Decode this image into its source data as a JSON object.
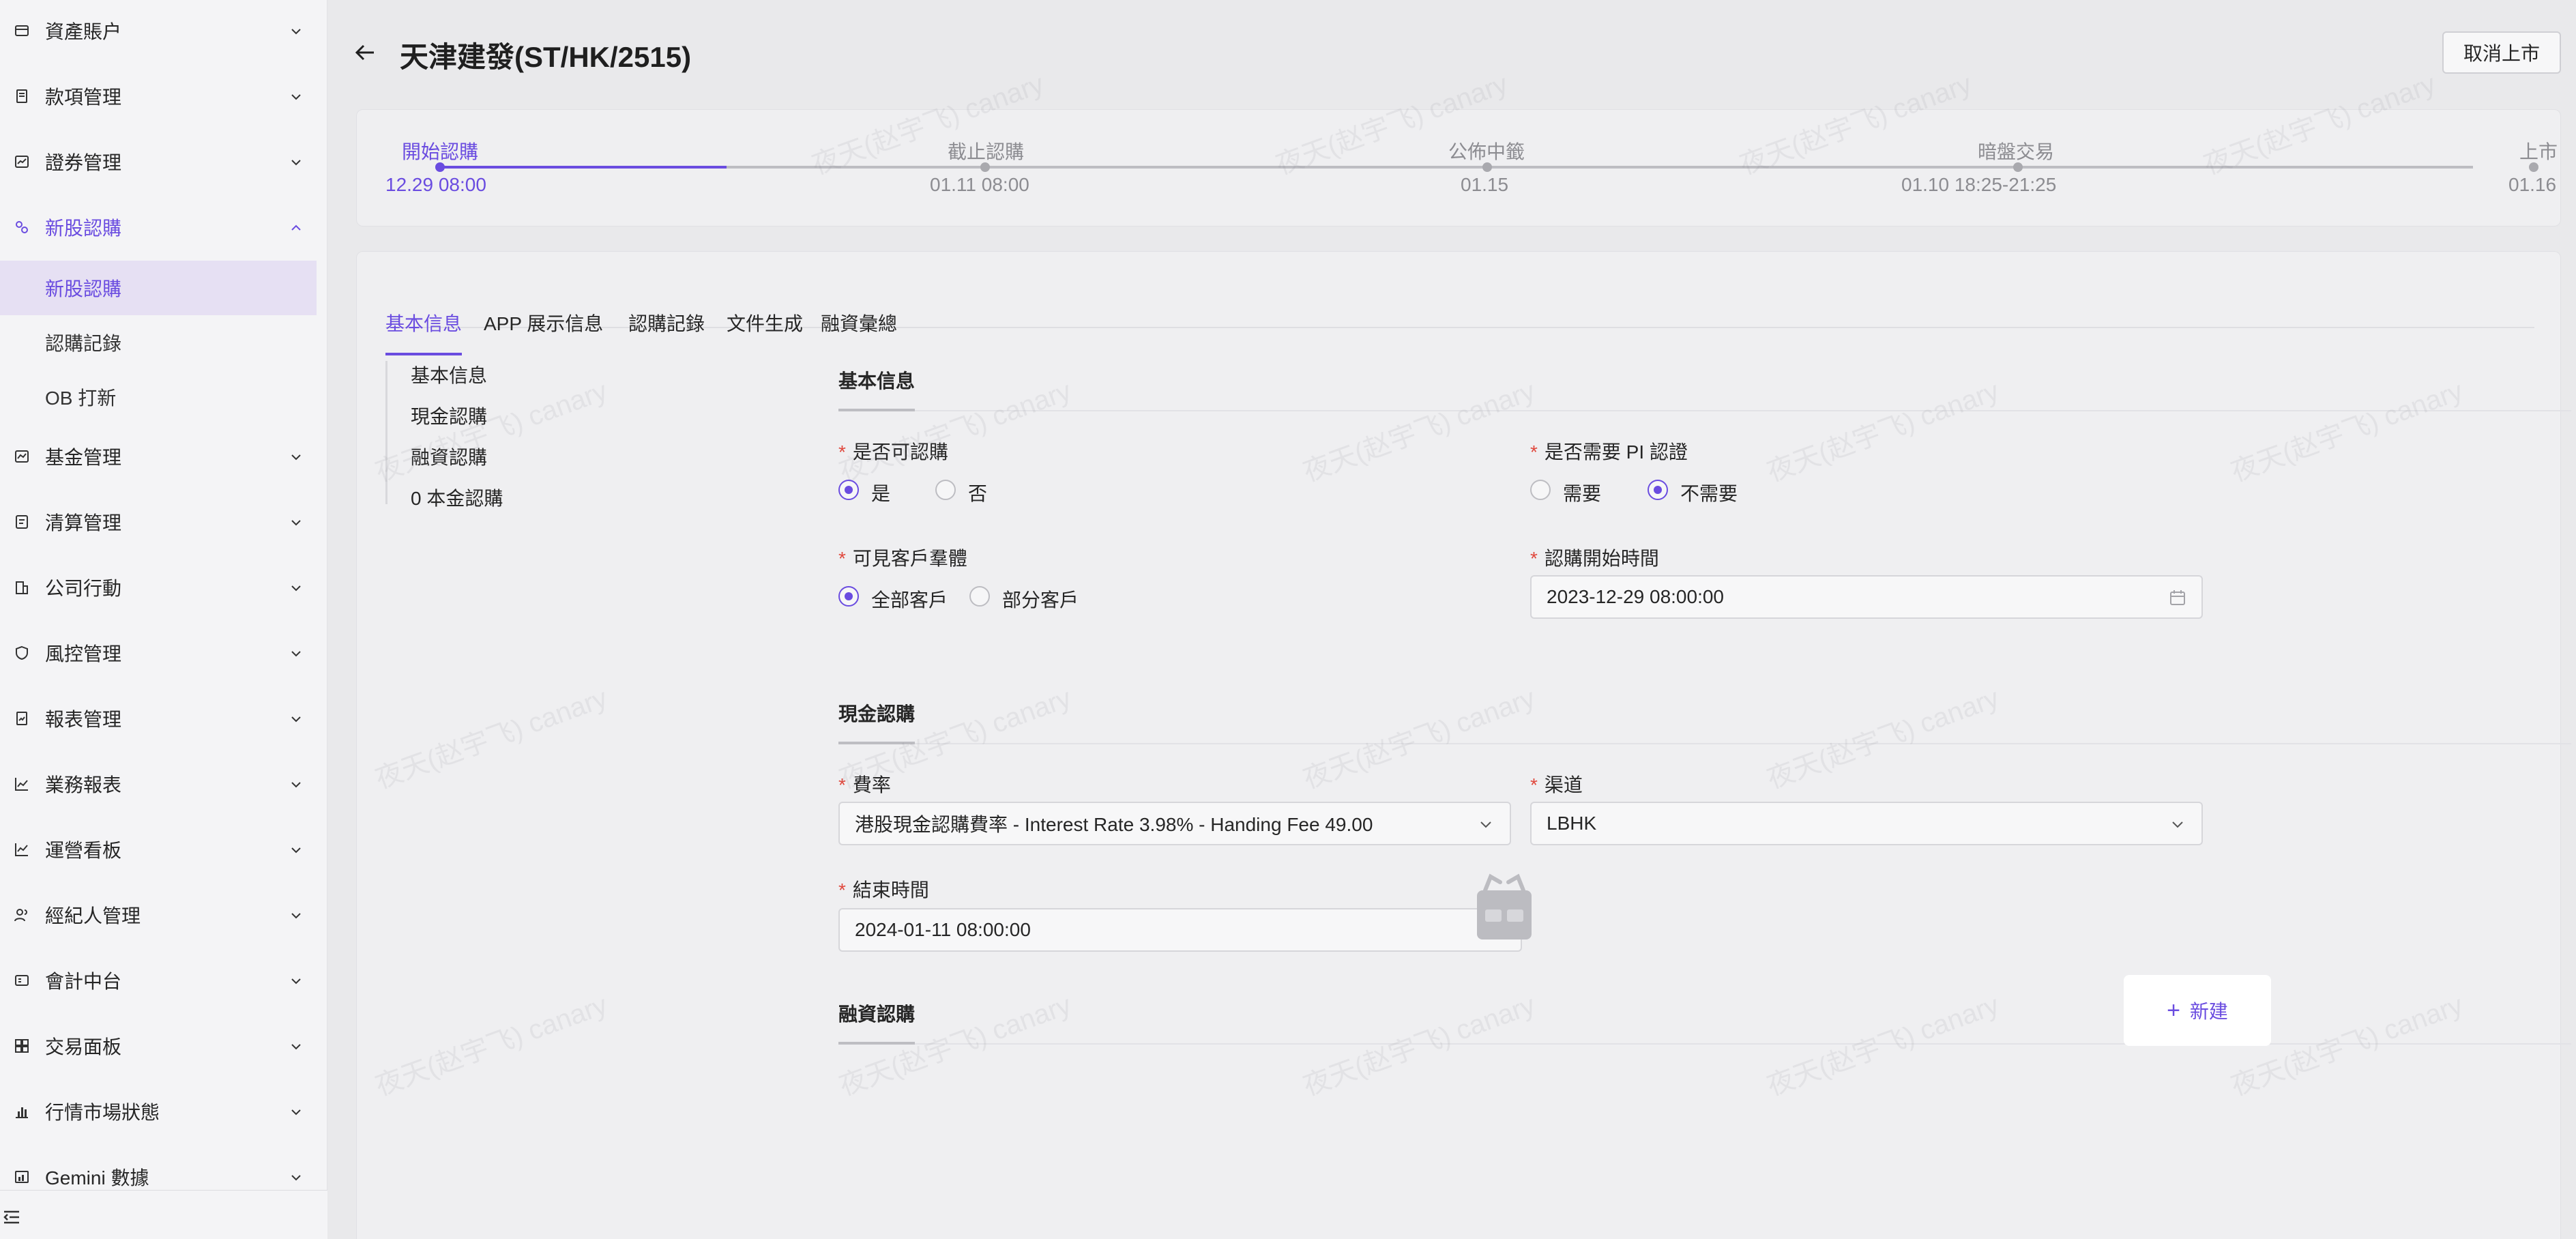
{
  "sidebar": {
    "items": [
      {
        "label": "資產賬户",
        "icon": "wallet-icon"
      },
      {
        "label": "款項管理",
        "icon": "receipt-icon"
      },
      {
        "label": "證券管理",
        "icon": "chart-box-icon"
      },
      {
        "label": "新股認購",
        "icon": "ipo-icon",
        "open": true,
        "children": [
          {
            "label": "新股認購",
            "active": true
          },
          {
            "label": "認購記錄"
          },
          {
            "label": "OB 打新"
          }
        ]
      },
      {
        "label": "基金管理",
        "icon": "fund-icon"
      },
      {
        "label": "清算管理",
        "icon": "clearing-icon"
      },
      {
        "label": "公司行動",
        "icon": "building-icon"
      },
      {
        "label": "風控管理",
        "icon": "shield-icon"
      },
      {
        "label": "報表管理",
        "icon": "report-icon"
      },
      {
        "label": "業務報表",
        "icon": "line-chart-icon"
      },
      {
        "label": "運營看板",
        "icon": "dashboard-icon"
      },
      {
        "label": "經紀人管理",
        "icon": "users-icon"
      },
      {
        "label": "會計中台",
        "icon": "accounting-icon"
      },
      {
        "label": "交易面板",
        "icon": "grid-icon"
      },
      {
        "label": "行情市場狀態",
        "icon": "bar-chart-icon"
      },
      {
        "label": "Gemini 數據",
        "icon": "data-icon"
      }
    ]
  },
  "header": {
    "title": "天津建發(ST/HK/2515)",
    "cancel_label": "取消上市"
  },
  "steps": [
    {
      "label": "開始認購",
      "time": "12.29 08:00",
      "done": true
    },
    {
      "label": "截止認購",
      "time": "01.11 08:00"
    },
    {
      "label": "公佈中籤",
      "time": "01.15"
    },
    {
      "label": "暗盤交易",
      "time": "01.10 18:25-21:25"
    },
    {
      "label": "上市",
      "time": "01.16"
    }
  ],
  "tabs": [
    "基本信息",
    "APP 展示信息",
    "認購記錄",
    "文件生成",
    "融資彙總"
  ],
  "active_tab": "基本信息",
  "anchor_nav": [
    "基本信息",
    "現金認購",
    "融資認購",
    "0 本金認購"
  ],
  "form": {
    "basic": {
      "title": "基本信息",
      "subscribable": {
        "label": "是否可認購",
        "options": [
          "是",
          "否"
        ],
        "selected": "是"
      },
      "pi_required": {
        "label": "是否需要 PI 認證",
        "options": [
          "需要",
          "不需要"
        ],
        "selected": "不需要"
      },
      "visible_clients": {
        "label": "可見客戶羣體",
        "options": [
          "全部客戶",
          "部分客戶"
        ],
        "selected": "全部客戶"
      },
      "start_time": {
        "label": "認購開始時間",
        "value": "2023-12-29 08:00:00"
      }
    },
    "cash": {
      "title": "現金認購",
      "rate": {
        "label": "費率",
        "value": "港股現金認購費率 - Interest Rate 3.98% - Handing Fee 49.00"
      },
      "channel": {
        "label": "渠道",
        "value": "LBHK"
      },
      "end_time": {
        "label": "結束時間",
        "value": "2024-01-11 08:00:00"
      }
    },
    "financing": {
      "title": "融資認購",
      "new_label": "新建"
    }
  },
  "watermark_text": "夜天(赵宇飞) canary",
  "colors": {
    "accent": "#6a4ce0",
    "required": "#e0483d"
  }
}
